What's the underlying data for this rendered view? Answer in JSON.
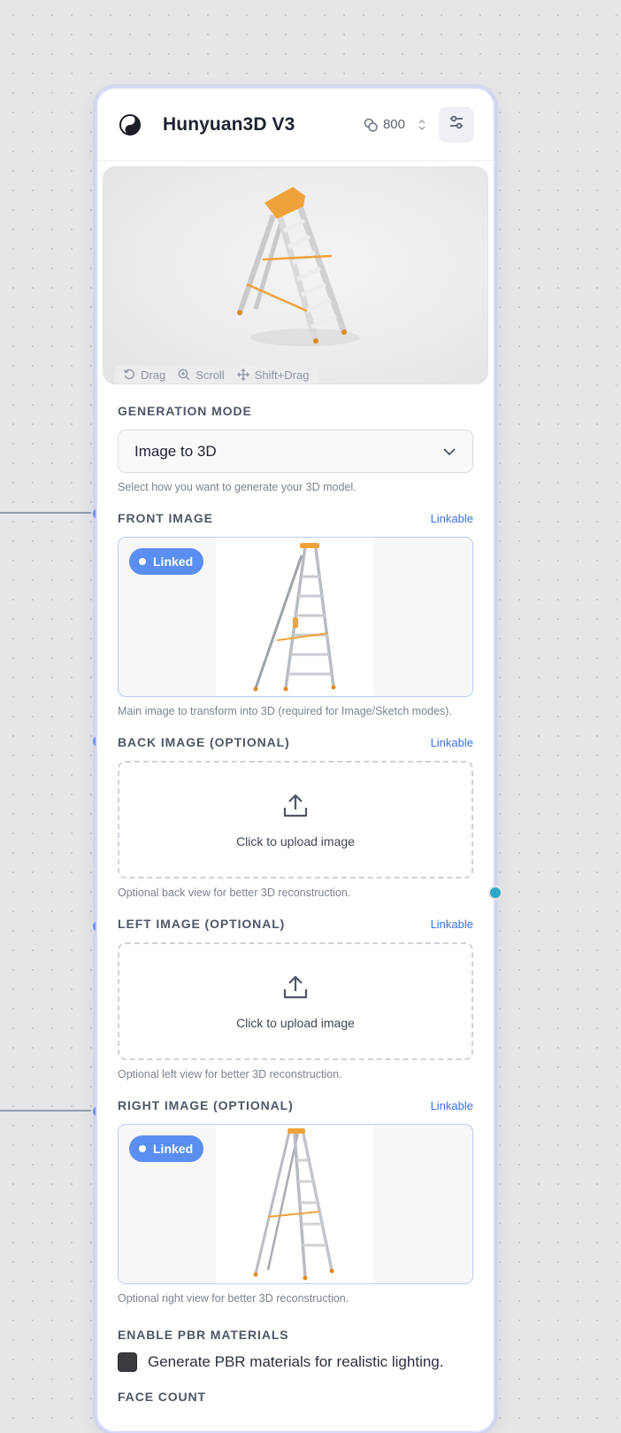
{
  "node": {
    "title": "Hunyuan3D V3",
    "credits": "800"
  },
  "preview": {
    "hints": [
      {
        "label": "Drag",
        "icon": "rotate-icon"
      },
      {
        "label": "Scroll",
        "icon": "zoom-icon"
      },
      {
        "label": "Shift+Drag",
        "icon": "move-icon"
      }
    ]
  },
  "generation_mode": {
    "label": "GENERATION MODE",
    "value": "Image to 3D",
    "help": "Select how you want to generate your 3D model."
  },
  "front_image": {
    "label": "FRONT IMAGE",
    "linkable": "Linkable",
    "badge": "Linked",
    "help": "Main image to transform into 3D (required for Image/Sketch modes)."
  },
  "back_image": {
    "label": "BACK IMAGE (OPTIONAL)",
    "linkable": "Linkable",
    "upload_text": "Click to upload image",
    "help": "Optional back view for better 3D reconstruction."
  },
  "left_image": {
    "label": "LEFT IMAGE (OPTIONAL)",
    "linkable": "Linkable",
    "upload_text": "Click to upload image",
    "help": "Optional left view for better 3D reconstruction."
  },
  "right_image": {
    "label": "RIGHT IMAGE (OPTIONAL)",
    "linkable": "Linkable",
    "badge": "Linked",
    "help": "Optional right view for better 3D reconstruction."
  },
  "pbr": {
    "label": "ENABLE PBR MATERIALS",
    "checkbox_label": "Generate PBR materials for realistic lighting."
  },
  "face_count": {
    "label": "FACE COUNT"
  },
  "colors": {
    "accent": "#3a70e0",
    "port": "#3f7de6",
    "badge": "#5a8ef0",
    "ladder_orange": "#f0a23a"
  }
}
